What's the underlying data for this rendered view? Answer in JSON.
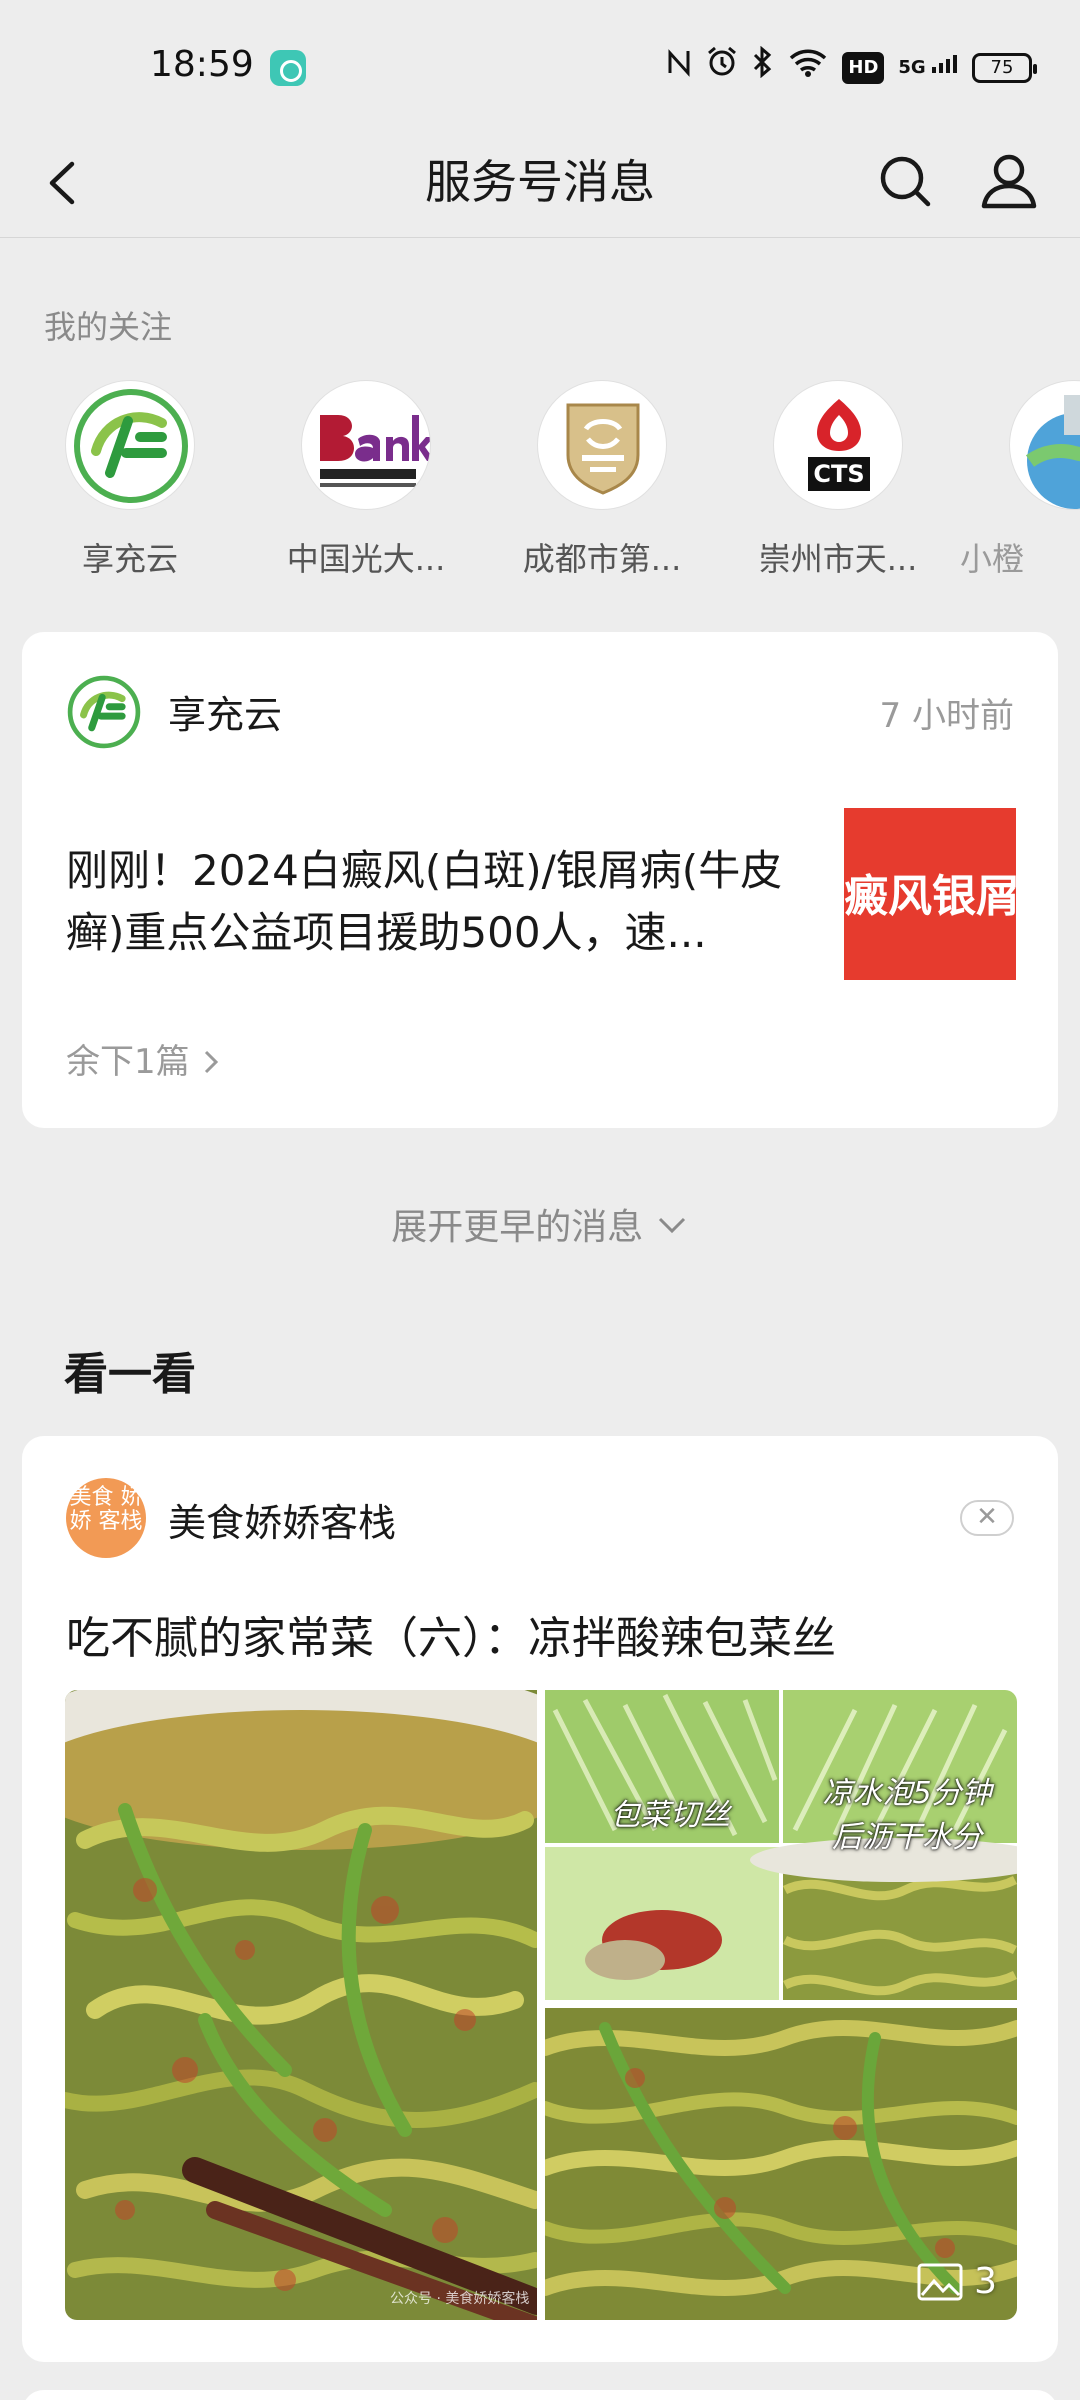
{
  "status_bar": {
    "time": "18:59",
    "hd": "HD",
    "network": "5G",
    "battery": "75"
  },
  "nav": {
    "title": "服务号消息"
  },
  "follow": {
    "label": "我的关注",
    "items": [
      {
        "name": "享充云"
      },
      {
        "name": "中国光大..."
      },
      {
        "name": "成都市第..."
      },
      {
        "name": "崇州市天..."
      },
      {
        "name": "小橙"
      }
    ]
  },
  "message_card": {
    "source": "享充云",
    "time": "7 小时前",
    "title": "刚刚！2024白癜风(白斑)/银屑病(牛皮癣)重点公益项目援助500人，速...",
    "thumb_text": "癜风银屑",
    "remaining": "余下1篇"
  },
  "expand_label": "展开更早的消息",
  "section_title": "看一看",
  "recommend_card": {
    "source": "美食娇娇客栈",
    "avatar_text": "美食 娇娇 客栈",
    "close": "✕",
    "title": "吃不腻的家常菜（六）：凉拌酸辣包菜丝",
    "caption_1": "包菜切丝",
    "caption_2": "凉水泡5分钟 后沥干水分",
    "image_count": "3",
    "watermark": "公众号 · 美食娇娇客栈"
  },
  "colors": {
    "background": "#ededed",
    "card": "#ffffff",
    "thumb_red": "#e63b2e",
    "muted_text": "#9a9a9a"
  }
}
